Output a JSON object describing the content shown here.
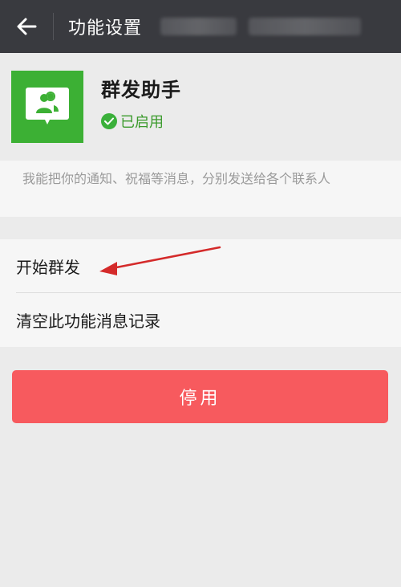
{
  "topbar": {
    "title": "功能设置",
    "back_icon": "arrow-left-icon"
  },
  "plugin": {
    "name": "群发助手",
    "status": "已启用",
    "icon": "group-chat-icon",
    "description": "我能把你的通知、祝福等消息，分别发送给各个联系人"
  },
  "menu": {
    "items": [
      {
        "label": "开始群发"
      },
      {
        "label": "清空此功能消息记录"
      }
    ]
  },
  "actions": {
    "disable_label": "停用"
  },
  "colors": {
    "topbar": "#393a3f",
    "icon_bg": "#3cb034",
    "status": "#3a9a2b",
    "disable_btn": "#f75a5e",
    "annotation_arrow": "#d42a2a"
  }
}
